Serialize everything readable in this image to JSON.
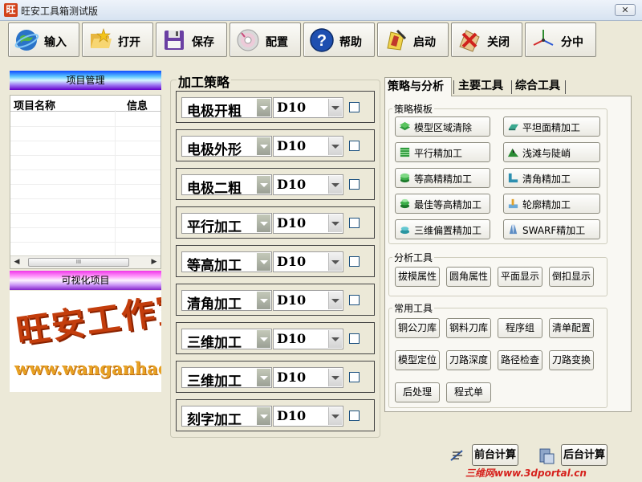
{
  "window": {
    "title": "旺安工具箱测试版",
    "app_icon_text": "旺",
    "close_symbol": "✕"
  },
  "toolbar": [
    {
      "label": "输入",
      "icon": "globe-icon"
    },
    {
      "label": "打开",
      "icon": "open-folder-icon"
    },
    {
      "label": "保存",
      "icon": "floppy-disk-icon"
    },
    {
      "label": "配置",
      "icon": "cd-disc-icon"
    },
    {
      "label": "帮助",
      "icon": "help-icon"
    },
    {
      "label": "启动",
      "icon": "start-tool-icon"
    },
    {
      "label": "关闭",
      "icon": "close-tool-icon"
    },
    {
      "label": "分中",
      "icon": "axis-center-icon"
    }
  ],
  "project_panel": {
    "header": "项目管理",
    "columns": [
      "项目名称",
      "信息"
    ],
    "scroll_thumb_text": "III"
  },
  "visual_panel": {
    "header": "可视化项目",
    "logo_text": "旺安工作室",
    "logo_url": "www.wanganhao.cn"
  },
  "strategy": {
    "title": "加工策略",
    "rows": [
      {
        "operation": "电极开粗",
        "tool": "D10",
        "checked": false
      },
      {
        "operation": "电极外形",
        "tool": "D10",
        "checked": false
      },
      {
        "operation": "电极二粗",
        "tool": "D10",
        "checked": false
      },
      {
        "operation": "平行加工",
        "tool": "D10",
        "checked": false
      },
      {
        "operation": "等高加工",
        "tool": "D10",
        "checked": false
      },
      {
        "operation": "清角加工",
        "tool": "D10",
        "checked": false
      },
      {
        "operation": "三维加工",
        "tool": "D10",
        "checked": false
      },
      {
        "operation": "三维加工",
        "tool": "D10",
        "checked": false
      },
      {
        "operation": "刻字加工",
        "tool": "D10",
        "checked": false
      }
    ]
  },
  "tabs": [
    {
      "label": "策略与分析",
      "active": true
    },
    {
      "label": "主要工具",
      "active": false
    },
    {
      "label": "综合工具",
      "active": false
    }
  ],
  "templates": {
    "label": "策略模板",
    "items": [
      {
        "label": "模型区域清除",
        "icon": "area-clear-icon"
      },
      {
        "label": "平坦面精加工",
        "icon": "flat-finish-icon"
      },
      {
        "label": "平行精加工",
        "icon": "parallel-finish-icon"
      },
      {
        "label": "浅滩与陡峭",
        "icon": "shallow-steep-icon"
      },
      {
        "label": "等高精精加工",
        "icon": "contour-finish-icon"
      },
      {
        "label": "清角精加工",
        "icon": "corner-finish-icon"
      },
      {
        "label": "最佳等高精加工",
        "icon": "optimized-contour-icon"
      },
      {
        "label": "轮廓精加工",
        "icon": "profile-finish-icon"
      },
      {
        "label": "三维偏置精加工",
        "icon": "offset-3d-icon"
      },
      {
        "label": "SWARF精加工",
        "icon": "swarf-finish-icon"
      }
    ]
  },
  "analysis": {
    "label": "分析工具",
    "buttons": [
      "拔模属性",
      "圆角属性",
      "平面显示",
      "倒扣显示"
    ]
  },
  "common": {
    "label": "常用工具",
    "buttons": [
      "铜公刀库",
      "钢料刀库",
      "程序组",
      "清单配置",
      "模型定位",
      "刀路深度",
      "路径检查",
      "刀路变换",
      "后处理",
      "程式单"
    ]
  },
  "bottom": {
    "front_calc": "前台计算",
    "back_calc": "后台计算",
    "watermark": "三维网www.3dportal.cn"
  }
}
